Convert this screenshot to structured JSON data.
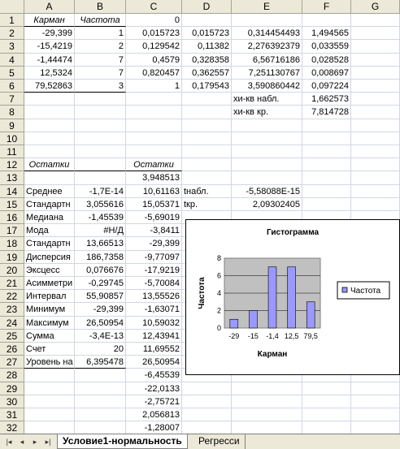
{
  "columns": [
    "A",
    "B",
    "C",
    "D",
    "E",
    "F",
    "G"
  ],
  "rows": [
    "1",
    "2",
    "3",
    "4",
    "5",
    "6",
    "7",
    "8",
    "9",
    "10",
    "11",
    "12",
    "13",
    "14",
    "15",
    "16",
    "17",
    "18",
    "19",
    "20",
    "21",
    "22",
    "23",
    "24",
    "25",
    "26",
    "27",
    "28",
    "29",
    "30",
    "31",
    "32"
  ],
  "cells": {
    "A1": "Карман",
    "B1": "Частота",
    "C1": "0",
    "A2": "-29,399",
    "B2": "1",
    "C2": "0,015723",
    "D2": "0,015723",
    "E2": "0,314454493",
    "F2": "1,494565",
    "A3": "-15,4219",
    "B3": "2",
    "C3": "0,129542",
    "D3": "0,11382",
    "E3": "2,276392379",
    "F3": "0,033559",
    "A4": "-1,44474",
    "B4": "7",
    "C4": "0,4579",
    "D4": "0,328358",
    "E4": "6,56716186",
    "F4": "0,028528",
    "A5": "12,5324",
    "B5": "7",
    "C5": "0,820457",
    "D5": "0,362557",
    "E5": "7,251130767",
    "F5": "0,008697",
    "A6": "79,52863",
    "B6": "3",
    "C6": "1",
    "D6": "0,179543",
    "E6": "3,590860442",
    "F6": "0,097224",
    "E7": "хи-кв набл.",
    "F7": "1,662573",
    "E8": "хи-кв кр.",
    "F8": "7,814728",
    "A12": "Остатки",
    "C12": "Остатки",
    "C13": "3,948513",
    "A14": "Среднее",
    "B14": "-1,7E-14",
    "C14": "10,61163",
    "D14": "tнабл.",
    "E14": "-5,58088E-15",
    "A15": "Стандартн",
    "B15": "3,055616",
    "C15": "15,05371",
    "D15": "tкр.",
    "E15": "2,09302405",
    "A16": "Медиана",
    "B16": "-1,45539",
    "C16": "-5,69019",
    "A17": "Мода",
    "B17": "#Н/Д",
    "C17": "-3,8411",
    "A18": "Стандартн",
    "B18": "13,66513",
    "C18": "-29,399",
    "A19": "Дисперсия",
    "B19": "186,7358",
    "C19": "-9,77097",
    "A20": "Эксцесс",
    "B20": "0,076676",
    "C20": "-17,9219",
    "A21": "Асимметри",
    "B21": "-0,29745",
    "C21": "-5,70084",
    "A22": "Интервал",
    "B22": "55,90857",
    "C22": "13,55526",
    "A23": "Минимум",
    "B23": "-29,399",
    "C23": "-1,63071",
    "A24": "Максимум",
    "B24": "26,50954",
    "C24": "10,59032",
    "A25": "Сумма",
    "B25": "-3,4E-13",
    "C25": "12,43941",
    "A26": "Счет",
    "B26": "20",
    "C26": "11,69552",
    "A27": "Уровень на",
    "B27": "6,395478",
    "C27": "26,50954",
    "C28": "-6,45539",
    "C29": "-22,0133",
    "C30": "-2,75721",
    "C31": "2,056813",
    "C32": "-1,28007"
  },
  "chart": {
    "title": "Гистограмма",
    "ylabel": "Частота",
    "xlabel": "Карман",
    "legend": "Частота"
  },
  "chart_data": {
    "type": "bar",
    "title": "Гистограмма",
    "xlabel": "Карман",
    "ylabel": "Частота",
    "categories": [
      "-29",
      "-15",
      "-1,4",
      "12,5",
      "79,5"
    ],
    "series": [
      {
        "name": "Частота",
        "values": [
          1,
          2,
          7,
          7,
          3
        ]
      }
    ],
    "yticks": [
      "0",
      "2",
      "4",
      "6",
      "8"
    ],
    "ylim": [
      0,
      8
    ],
    "legend": "right",
    "bar_color": "#9999ff",
    "plot_bg": "#c0c0c0"
  },
  "tabs": {
    "nav_first": "|◂",
    "nav_prev": "◂",
    "nav_next": "▸",
    "nav_last": "▸|",
    "active": "Условие1-нормальность",
    "next": "Регресси"
  }
}
